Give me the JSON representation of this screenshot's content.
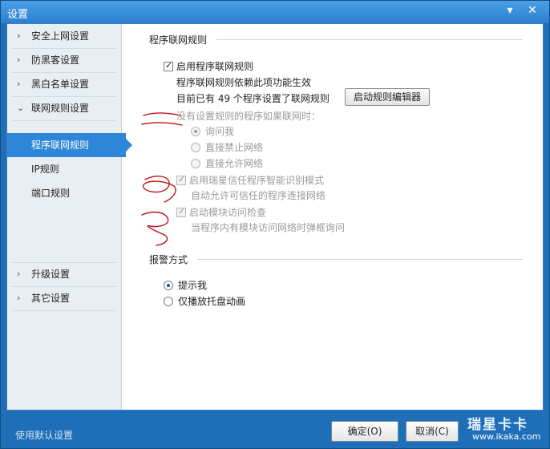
{
  "window": {
    "title": "设置",
    "minimize_glyph": "▾",
    "close_glyph": "✕"
  },
  "sidebar": {
    "items": [
      {
        "label": "安全上网设置",
        "chevron": "›"
      },
      {
        "label": "防黑客设置",
        "chevron": "›"
      },
      {
        "label": "黑白名单设置",
        "chevron": "›"
      },
      {
        "label": "联网规则设置",
        "chevron": "⌄"
      },
      {
        "label": "升级设置",
        "chevron": "›"
      },
      {
        "label": "其它设置",
        "chevron": "›"
      }
    ],
    "sub_items": [
      {
        "label": "程序联网规则",
        "active": true
      },
      {
        "label": "IP规则",
        "active": false
      },
      {
        "label": "端口规则",
        "active": false
      }
    ]
  },
  "content": {
    "section1_title": "程序联网规则",
    "enable_rules_label": "启用程序联网规则",
    "enable_rules_checked": true,
    "rules_note": "程序联网规则依赖此项功能生效",
    "current_count_text": "目前已有 49 个程序设置了联网规则",
    "editor_button": "启动规则编辑器",
    "no_rule_prompt": "没有设置规则的程序如果联网时：",
    "options": [
      {
        "label": "询问我",
        "checked": true
      },
      {
        "label": "直接禁止网络",
        "checked": false
      },
      {
        "label": "直接允许网络",
        "checked": false
      }
    ],
    "smart_mode_label": "启用瑞星信任程序智能识别模式",
    "smart_mode_checked": true,
    "smart_mode_note": "自动允许可信任的程序连接网络",
    "module_check_label": "启动模块访问检查",
    "module_check_checked": true,
    "module_check_note": "当程序内有模块访问网络时弹框询问",
    "section2_title": "报警方式",
    "alert_options": [
      {
        "label": "提示我",
        "checked": true
      },
      {
        "label": "仅播放托盘动画",
        "checked": false
      }
    ]
  },
  "footer": {
    "default_link": "使用默认设置",
    "ok_button": "确定(O)",
    "cancel_button": "取消(C)"
  },
  "watermark": {
    "text": "瑞星卡卡",
    "url": "www.ikaka.com"
  },
  "colors": {
    "accent": "#2d86d7",
    "frame": "#1f6fb8",
    "annotation": "#c0141c"
  }
}
